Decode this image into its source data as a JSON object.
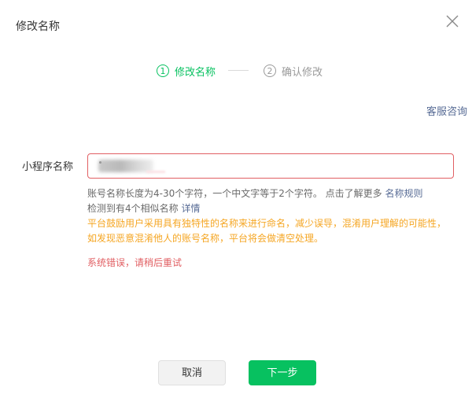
{
  "dialog": {
    "title": "修改名称"
  },
  "steps": [
    {
      "number": "1",
      "label": "修改名称",
      "active": true
    },
    {
      "number": "2",
      "label": "确认修改",
      "active": false
    }
  ],
  "support_link": "客服咨询",
  "form": {
    "label": "小程序名称",
    "value": ""
  },
  "hints": {
    "length_rule": "账号名称长度为4-30个字符，一个中文字等于2个字符。 点击了解更多",
    "rule_link": "名称规则",
    "similar_text": "检测到有4个相似名称",
    "similar_link": "详情",
    "warning": "平台鼓励用户采用具有独特性的名称来进行命名，减少误导，混淆用户理解的可能性，如发现恶意混淆他人的账号名称，平台将会做清空处理。",
    "error": "系统错误，请稍后重试"
  },
  "buttons": {
    "cancel": "取消",
    "next": "下一步"
  },
  "colors": {
    "primary": "#07c160",
    "link": "#576b95",
    "warning": "#f5a623",
    "error": "#e15f63"
  }
}
